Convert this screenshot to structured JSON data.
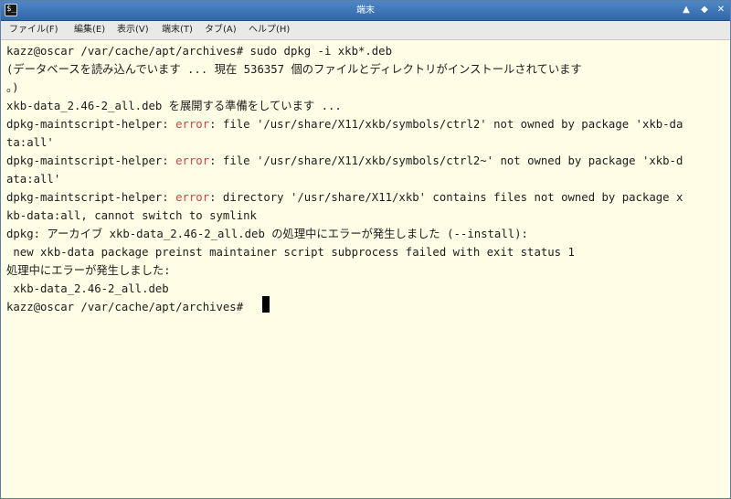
{
  "window": {
    "title": "端末",
    "app_icon": "terminal-icon",
    "app_icon_glyph": "$_",
    "buttons": {
      "minimize": "▲",
      "maximize": "◆",
      "close": "✕"
    }
  },
  "menubar": {
    "items": [
      {
        "label": "ファイル(F)"
      },
      {
        "label": "編集(E)"
      },
      {
        "label": "表示(V)"
      },
      {
        "label": "端末(T)"
      },
      {
        "label": "タブ(A)"
      },
      {
        "label": "ヘルプ(H)"
      }
    ]
  },
  "terminal": {
    "colors": {
      "background": "#fffde6",
      "text": "#1c1c1c",
      "error": "#d6453d"
    },
    "lines": [
      {
        "segments": [
          {
            "text": "kazz@oscar /var/cache/apt/archives# sudo dpkg -i xkb*.deb"
          }
        ]
      },
      {
        "segments": [
          {
            "text": "(データベースを読み込んでいます ... 現在 536357 個のファイルとディレクトリがインストールされています"
          }
        ]
      },
      {
        "segments": [
          {
            "text": "。)"
          }
        ]
      },
      {
        "segments": [
          {
            "text": "xkb-data_2.46-2_all.deb を展開する準備をしています ..."
          }
        ]
      },
      {
        "segments": [
          {
            "text": "dpkg-maintscript-helper: "
          },
          {
            "text": "error",
            "error": true
          },
          {
            "text": ": file '/usr/share/X11/xkb/symbols/ctrl2' not owned by package 'xkb-da"
          }
        ]
      },
      {
        "segments": [
          {
            "text": "ta:all'"
          }
        ]
      },
      {
        "segments": [
          {
            "text": "dpkg-maintscript-helper: "
          },
          {
            "text": "error",
            "error": true
          },
          {
            "text": ": file '/usr/share/X11/xkb/symbols/ctrl2~' not owned by package 'xkb-d"
          }
        ]
      },
      {
        "segments": [
          {
            "text": "ata:all'"
          }
        ]
      },
      {
        "segments": [
          {
            "text": "dpkg-maintscript-helper: "
          },
          {
            "text": "error",
            "error": true
          },
          {
            "text": ": directory '/usr/share/X11/xkb' contains files not owned by package x"
          }
        ]
      },
      {
        "segments": [
          {
            "text": "kb-data:all, cannot switch to symlink"
          }
        ]
      },
      {
        "segments": [
          {
            "text": "dpkg: アーカイブ xkb-data_2.46-2_all.deb の処理中にエラーが発生しました (--install):"
          }
        ]
      },
      {
        "segments": [
          {
            "text": " new xkb-data package preinst maintainer script subprocess failed with exit status 1"
          }
        ]
      },
      {
        "segments": [
          {
            "text": "処理中にエラーが発生しました:"
          }
        ]
      },
      {
        "segments": [
          {
            "text": " xkb-data_2.46-2_all.deb"
          }
        ]
      },
      {
        "segments": [
          {
            "text": "kazz@oscar /var/cache/apt/archives# "
          }
        ]
      }
    ]
  }
}
